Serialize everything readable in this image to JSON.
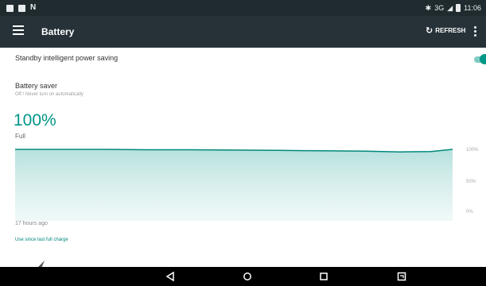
{
  "status_bar": {
    "network": "3G",
    "time": "11:06"
  },
  "app_bar": {
    "title": "Battery",
    "refresh_label": "REFRESH"
  },
  "standby_setting": {
    "label": "Standby intelligent power saving",
    "enabled": true
  },
  "battery_saver": {
    "title": "Battery saver",
    "subtitle": "Off / Never turn on automatically"
  },
  "battery": {
    "level": "100%",
    "state": "Full"
  },
  "chart_data": {
    "type": "area",
    "x": [
      0,
      0.1,
      0.2,
      0.3,
      0.4,
      0.5,
      0.6,
      0.7,
      0.8,
      0.88,
      0.95,
      1.0
    ],
    "values": [
      100,
      100,
      100,
      99.5,
      99.5,
      99,
      98.5,
      98,
      97.5,
      96.5,
      97,
      100
    ],
    "ylim": [
      0,
      100
    ],
    "y_tick_labels": [
      "100%",
      "50%",
      "0%"
    ],
    "x_label": "17 hours ago",
    "grid": false,
    "color": "#00897b"
  },
  "usage_link": "Use since last full charge",
  "colors": {
    "accent": "#009688",
    "app_bar": "#263238",
    "status_bar": "#1f2b2f",
    "nav_bar": "#000000"
  }
}
